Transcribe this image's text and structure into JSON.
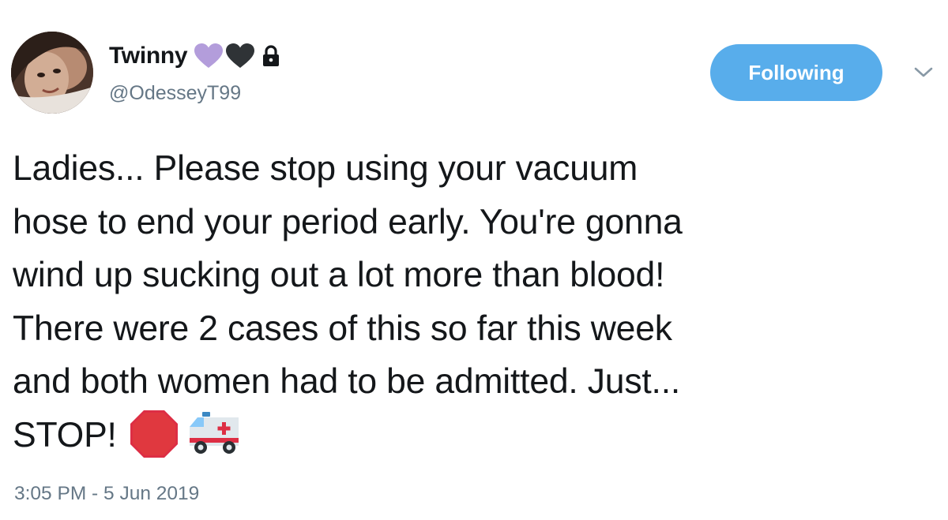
{
  "user": {
    "display_name": "Twinny",
    "handle": "@OdesseyT99",
    "badges": [
      "purple-heart-icon",
      "black-heart-icon",
      "lock-icon"
    ]
  },
  "follow_button": {
    "label": "Following"
  },
  "menu": {
    "icon": "chevron-down-icon"
  },
  "tweet": {
    "lines": [
      "Ladies... Please stop using your vacuum",
      "hose to end your period early. You're gonna",
      "wind up sucking out a lot more than blood!",
      "There were 2 cases of this so far this week",
      "and both women had to be admitted. Just...",
      "STOP!"
    ],
    "emojis": [
      "stop-sign-icon",
      "ambulance-icon"
    ],
    "timestamp": "3:05 PM - 5 Jun 2019"
  },
  "colors": {
    "accent": "#58adeb",
    "text": "#14171a",
    "secondary_text": "#657786",
    "purple_heart": "#b39ddb",
    "black_heart": "#2f3336"
  }
}
